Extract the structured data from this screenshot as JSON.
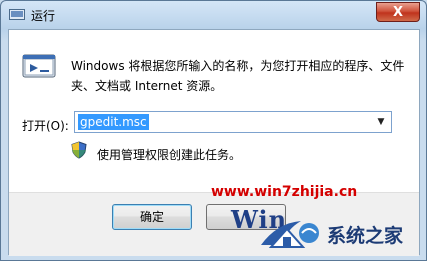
{
  "window": {
    "title": "运行",
    "close_label": "X"
  },
  "dialog": {
    "description": "Windows 将根据您所输入的名称，为您打开相应的程序、文件夹、文档或 Internet 资源。",
    "open_label": "打开(O):",
    "command_value": "gpedit.msc",
    "admin_note": "使用管理权限创建此任务。"
  },
  "buttons": {
    "ok_label": "确定",
    "cancel_label": ""
  },
  "watermark": {
    "url": "www.win7zhijia.cn",
    "logo_text": "Win",
    "site_name": "系统之家"
  },
  "colors": {
    "selection": "#3399ff",
    "watermark_red": "#d40000"
  }
}
